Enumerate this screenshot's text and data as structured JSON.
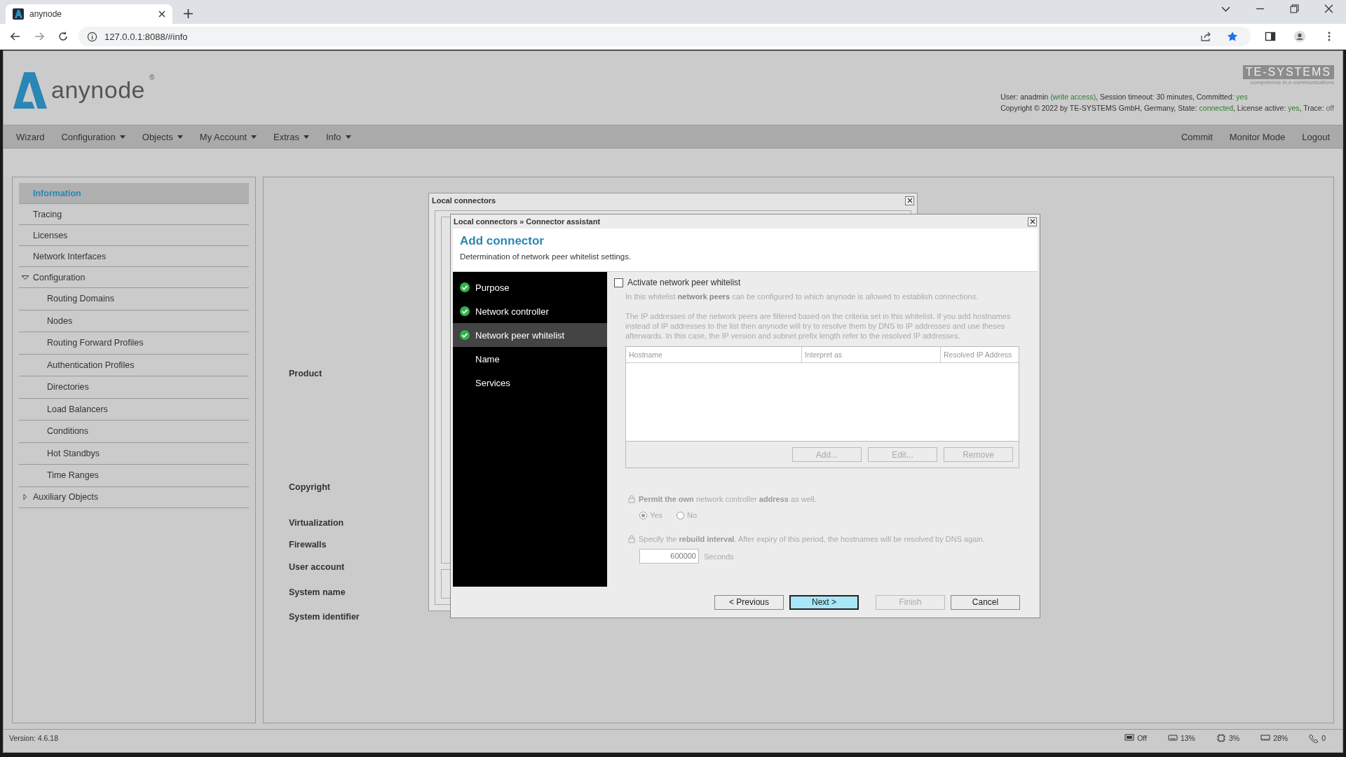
{
  "browser": {
    "tab_title": "anynode",
    "url": "127.0.0.1:8088/#info"
  },
  "header": {
    "brand": "anynode",
    "brand_mark": "®",
    "vendor": "TE-SYSTEMS",
    "vendor_tagline": "competence in e-communications",
    "status_lines": [
      [
        {
          "text": "User: anadmin ",
          "kind": "label"
        },
        {
          "text": "(write access)",
          "kind": "value"
        },
        {
          "text": ", Session timeout: 30 minutes, Committed: ",
          "kind": "label"
        },
        {
          "text": "yes",
          "kind": "value"
        }
      ],
      [
        {
          "text": "Copyright © 2022 by TE-SYSTEMS GmbH, Germany, State: ",
          "kind": "label"
        },
        {
          "text": "connected",
          "kind": "value"
        },
        {
          "text": ", License active: ",
          "kind": "label"
        },
        {
          "text": "yes",
          "kind": "value"
        },
        {
          "text": ", Trace: ",
          "kind": "label"
        },
        {
          "text": "off",
          "kind": "muted"
        }
      ]
    ]
  },
  "nav": {
    "left": [
      {
        "label": "Wizard",
        "dropdown": false
      },
      {
        "label": "Configuration",
        "dropdown": true
      },
      {
        "label": "Objects",
        "dropdown": true
      },
      {
        "label": "My Account",
        "dropdown": true
      },
      {
        "label": "Extras",
        "dropdown": true
      },
      {
        "label": "Info",
        "dropdown": true
      }
    ],
    "right": [
      {
        "label": "Commit",
        "dropdown": false
      },
      {
        "label": "Monitor Mode",
        "dropdown": false
      },
      {
        "label": "Logout",
        "dropdown": false
      }
    ]
  },
  "sidebar": {
    "items": [
      {
        "label": "Information",
        "selected": true
      },
      {
        "label": "Tracing",
        "selected": false
      },
      {
        "label": "Licenses",
        "selected": false
      },
      {
        "label": "Network Interfaces",
        "selected": false
      },
      {
        "label": "Configuration",
        "selected": false,
        "expanded": true,
        "children": [
          {
            "label": "Routing Domains",
            "selected": false
          },
          {
            "label": "Nodes",
            "selected": false
          },
          {
            "label": "Routing Forward Profiles",
            "selected": false
          },
          {
            "label": "Authentication Profiles",
            "selected": false
          },
          {
            "label": "Directories",
            "selected": false
          },
          {
            "label": "Load Balancers",
            "selected": false
          },
          {
            "label": "Conditions",
            "selected": false
          },
          {
            "label": "Hot Standbys",
            "selected": false
          },
          {
            "label": "Time Ranges",
            "selected": false
          }
        ]
      },
      {
        "label": "Auxiliary Objects",
        "selected": false,
        "expanded": false
      }
    ]
  },
  "info_labels": [
    "Product",
    "Copyright",
    "Virtualization",
    "Firewalls",
    "User account",
    "System name",
    "System identifier"
  ],
  "back_window": {
    "title": "Local connectors"
  },
  "assistant": {
    "title": "Local connectors » Connector assistant",
    "heading": "Add connector",
    "subtitle": "Determination of network peer whitelist settings.",
    "steps": [
      {
        "label": "Purpose",
        "done": true,
        "selected": false
      },
      {
        "label": "Network controller",
        "done": true,
        "selected": false
      },
      {
        "label": "Network peer whitelist",
        "done": true,
        "selected": true
      },
      {
        "label": "Name",
        "done": false,
        "selected": false
      },
      {
        "label": "Services",
        "done": false,
        "selected": false
      }
    ],
    "activate": {
      "label": "Activate network peer whitelist",
      "checked": false
    },
    "help": [
      "In this whitelist **network peers** can be configured to which anynode is allowed to establish connections.",
      "The IP addresses of the network peers are filtered based on the criteria set in this whitelist. If you add hostnames instead of IP addresses to the list then anynode will try to resolve them by DNS to IP addresses and use theses afterwards. In this case, the IP version and subnet prefix length refer to the resolved IP addresses."
    ],
    "table": {
      "columns": [
        "Hostname",
        "Interpret as",
        "Resolved IP Address"
      ],
      "buttons": [
        {
          "label": "Add...",
          "disabled": true
        },
        {
          "label": "Edit...",
          "disabled": true
        },
        {
          "label": "Remove",
          "disabled": true
        }
      ]
    },
    "permit": {
      "label": "**Permit the own** network controller **address** as well.",
      "locked": true,
      "options": [
        {
          "label": "Yes",
          "selected": true
        },
        {
          "label": "No",
          "selected": false
        }
      ]
    },
    "interval": {
      "label": "Specify the **rebuild interval**. After expiry of this period, the hostnames will be resolved by DNS again.",
      "locked": true,
      "value": "600000",
      "unit": "Seconds"
    },
    "buttons": [
      {
        "label": "< Previous",
        "disabled": false,
        "focused": false
      },
      {
        "label": "Next >",
        "disabled": false,
        "focused": true
      },
      {
        "label": "Finish",
        "disabled": true,
        "focused": false
      },
      {
        "label": "Cancel",
        "disabled": false,
        "focused": false
      }
    ]
  },
  "status_bar": {
    "version": "Version: 4.6.18",
    "indicators": [
      {
        "kind": "screen",
        "value": "Off"
      },
      {
        "kind": "drive",
        "value": "13%"
      },
      {
        "kind": "cpu",
        "value": "3%"
      },
      {
        "kind": "memory",
        "value": "28%"
      },
      {
        "kind": "calls",
        "value": "0"
      }
    ]
  }
}
